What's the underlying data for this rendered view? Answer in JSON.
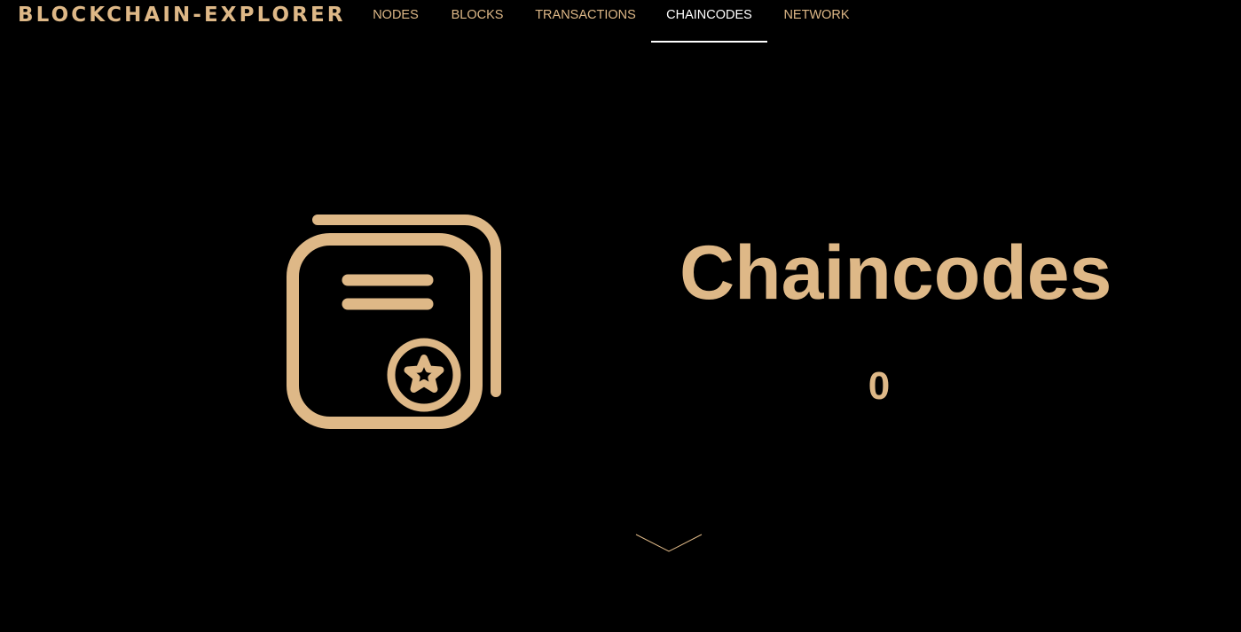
{
  "brand": {
    "title": "BLOCKCHAIN-EXPLORER"
  },
  "nav": {
    "items": [
      {
        "label": "NODES"
      },
      {
        "label": "BLOCKS"
      },
      {
        "label": "TRANSACTIONS"
      },
      {
        "label": "CHAINCODES",
        "active": true
      },
      {
        "label": "NETWORK"
      }
    ]
  },
  "section": {
    "icon": "certificate-document-icon",
    "title": "Chaincodes",
    "count": "0",
    "scroll_icon": "chevron-down-icon"
  },
  "colors": {
    "background": "#000000",
    "accent": "#deb887",
    "active_nav": "#ffffff"
  }
}
